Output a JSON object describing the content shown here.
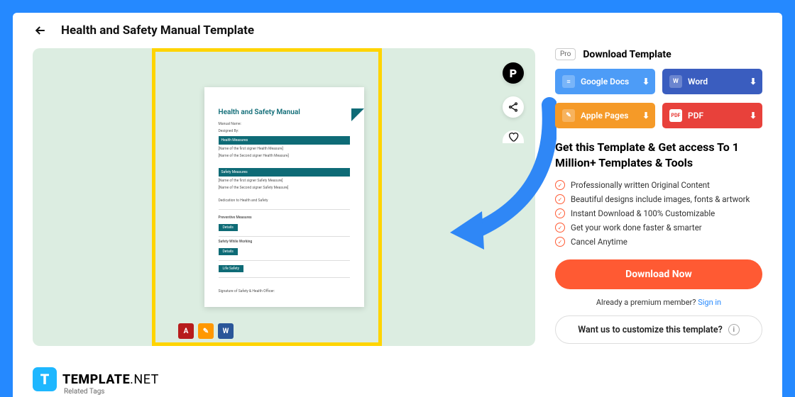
{
  "header": {
    "title": "Health and Safety Manual Template"
  },
  "preview": {
    "doc_title": "Health and Safety Manual",
    "fields": {
      "manual_name": "Manual Name:",
      "designed_by": "Designed By:",
      "bar1": "Health Measures",
      "line1a": "[Name of the first signer Health Measure]",
      "line1b": "[Name of the Second signer Health Measure]",
      "bar2": "Safety Measures",
      "line2a": "[Name of the first signer Safety Measure]",
      "line2b": "[Name of the Second signer Safety Measure]",
      "dedication": "Dedication to Health and Safety",
      "preventive": "Preventive Measures",
      "details1": "Details",
      "safety_working": "Safety While Working",
      "details2": "Details",
      "chip3": "Life Safety",
      "signature": "Signature of Safety & Health Officer:"
    }
  },
  "download": {
    "pro": "Pro",
    "heading": "Download Template",
    "buttons": {
      "gdocs": "Google Docs",
      "word": "Word",
      "pages": "Apple Pages",
      "pdf": "PDF"
    }
  },
  "promo": {
    "headline": "Get this Template & Get access To 1 Million+ Templates & Tools",
    "features": [
      "Professionally written Original Content",
      "Beautiful designs include images, fonts & artwork",
      "Instant Download & 100% Customizable",
      "Get your work done faster & smarter",
      "Cancel Anytime"
    ],
    "cta": "Download Now",
    "member_prefix": "Already a premium member? ",
    "signin": "Sign in",
    "customize": "Want us to customize this template?"
  },
  "logo": {
    "t": "T",
    "brand": "TEMPLATE",
    "net": ".NET"
  },
  "tags_label": "Related Tags"
}
